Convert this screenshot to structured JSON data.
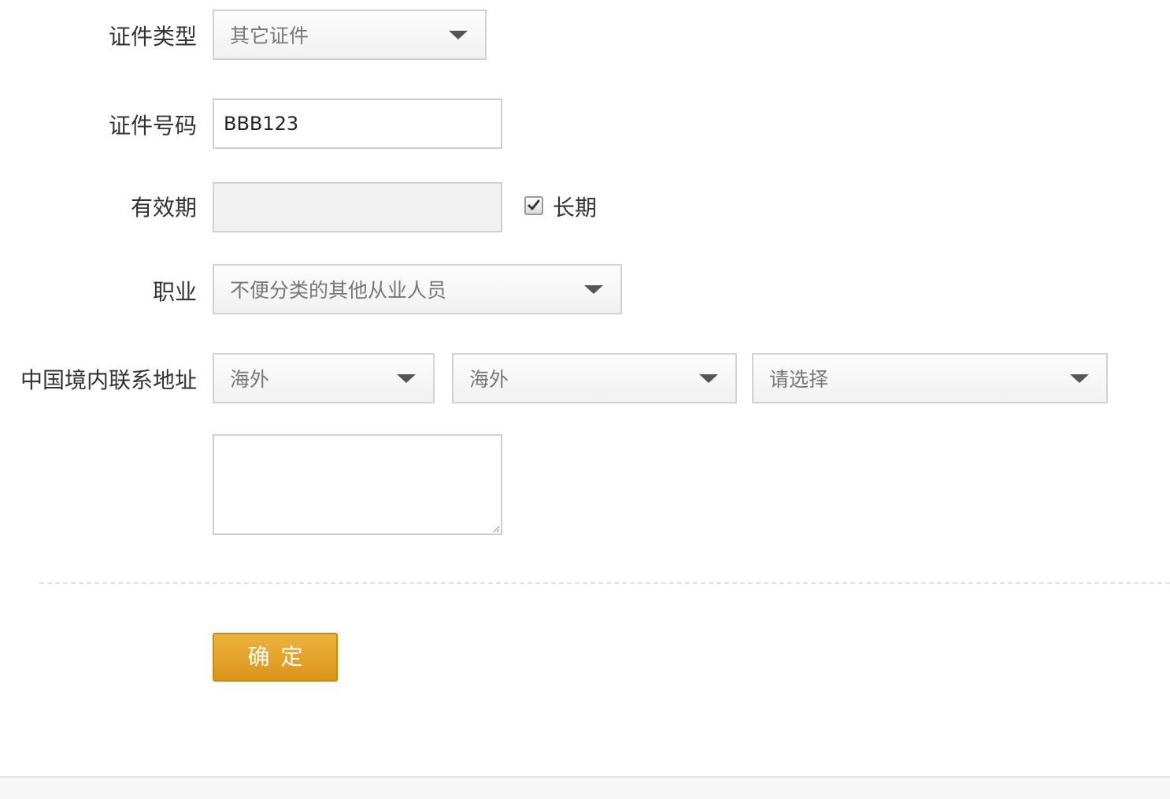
{
  "form": {
    "cert_type": {
      "label": "证件类型",
      "selected": "其它证件"
    },
    "cert_number": {
      "label": "证件号码",
      "value": "BBB123"
    },
    "validity": {
      "label": "有效期",
      "long_term_label": "长期",
      "long_term_checked": true
    },
    "occupation": {
      "label": "职业",
      "selected": "不便分类的其他从业人员"
    },
    "address": {
      "label": "中国境内联系地址",
      "province": "海外",
      "city": "海外",
      "district": "请选择",
      "detail": ""
    },
    "submit_label": "确定"
  }
}
